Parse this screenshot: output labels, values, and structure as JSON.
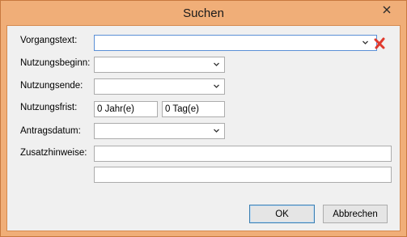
{
  "window": {
    "title": "Suchen"
  },
  "form": {
    "vorgangstext_label": "Vorgangstext:",
    "nutzungsbeginn_label": "Nutzungsbeginn:",
    "nutzungsende_label": "Nutzungsende:",
    "nutzungsfrist_label": "Nutzungsfrist:",
    "nutzungsfrist_jahre": "0 Jahr(e)",
    "nutzungsfrist_tage": "0 Tag(e)",
    "antragsdatum_label": "Antragsdatum:",
    "zusatzhinweise_label": "Zusatzhinweise:"
  },
  "buttons": {
    "ok": "OK",
    "abbrechen": "Abbrechen"
  },
  "icons": {
    "close": "close-icon",
    "dropdown": "chevron-down-icon",
    "clear": "red-x-icon"
  },
  "colors": {
    "titlebar": "#f0ae78",
    "clear_icon": "#e03a2e",
    "focus_border": "#5a8fd6"
  }
}
